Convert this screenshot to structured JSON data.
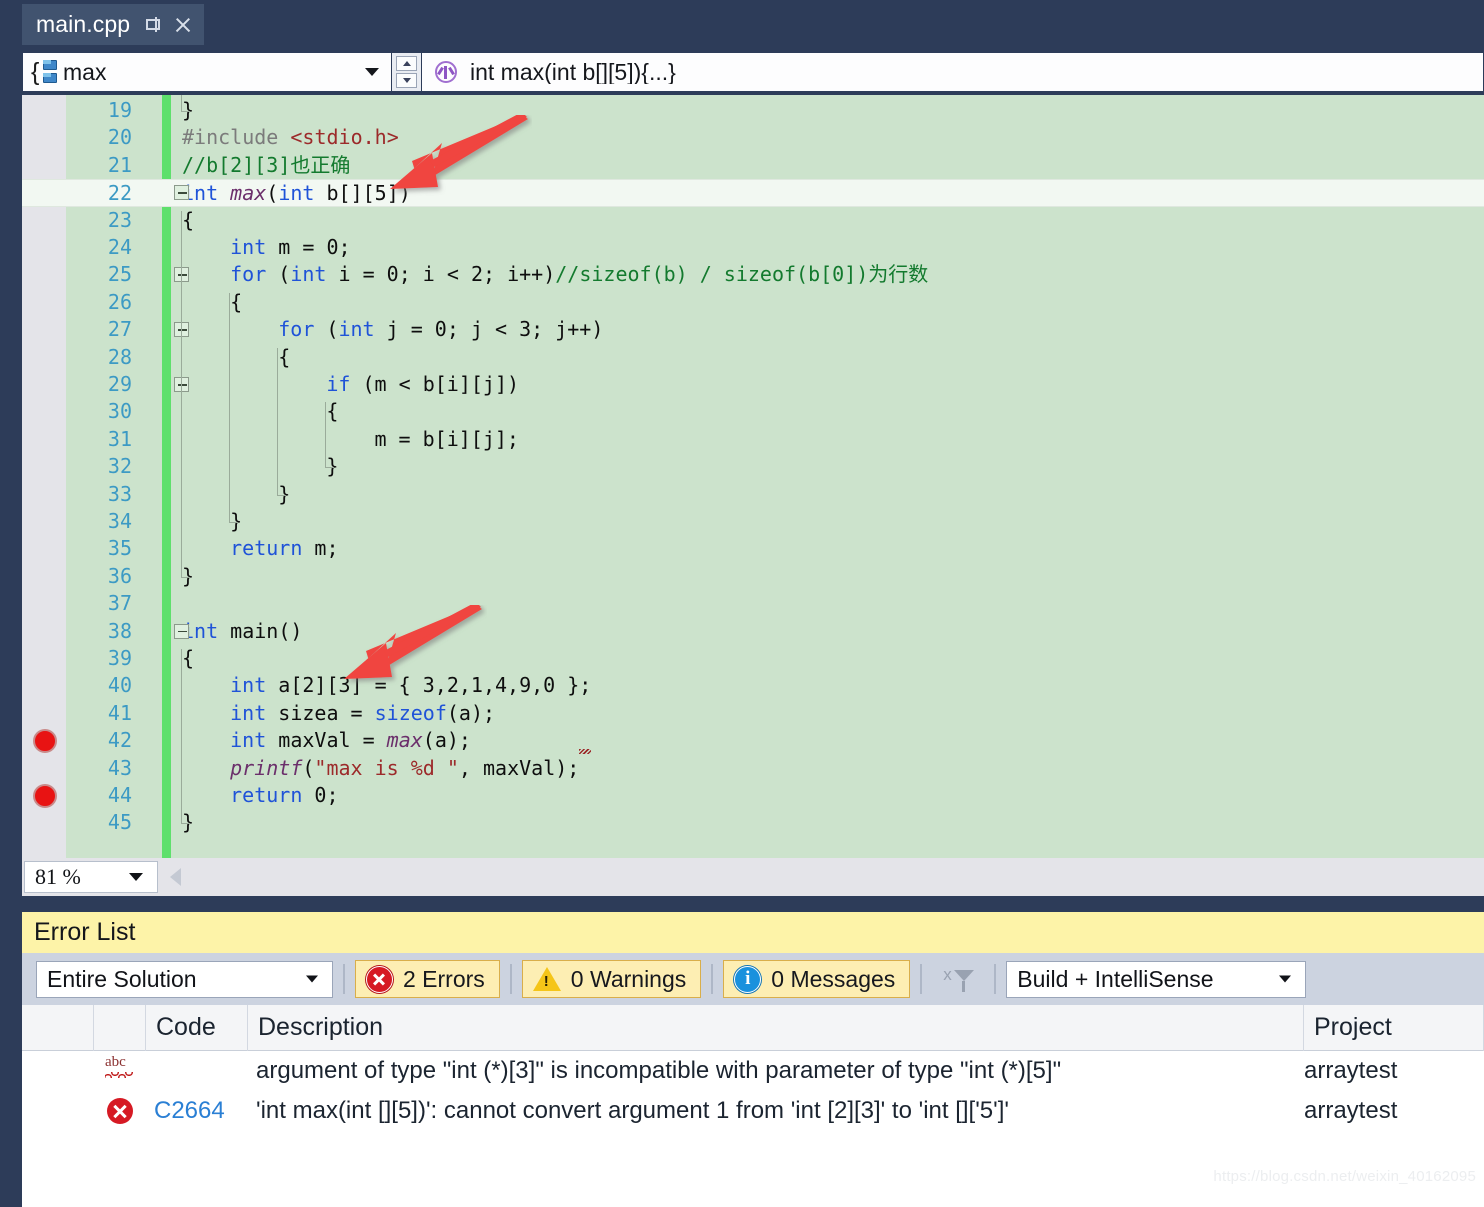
{
  "window": {
    "tab": {
      "title": "main.cpp",
      "pin_icon": "pin-icon",
      "close_icon": "close-icon"
    }
  },
  "navbar": {
    "scope_icon": "class-members-icon",
    "scope_value": "max",
    "member_icon": "method-icon",
    "member_value": "int max(int b[][5]){...}"
  },
  "editor": {
    "zoom_level": "81 %",
    "current_line": 22,
    "breakpoint_lines": [
      42,
      44
    ],
    "lines": [
      {
        "n": "19",
        "indent": 0,
        "html": "<span class=\"p\">}</span>"
      },
      {
        "n": "20",
        "indent": 0,
        "text": "#include <stdio.h>"
      },
      {
        "n": "21",
        "indent": 0,
        "text": "//b[2][3]也正确"
      },
      {
        "n": "22",
        "indent": 0,
        "text": "int max(int b[][5])"
      },
      {
        "n": "23",
        "indent": 0,
        "text": "{"
      },
      {
        "n": "24",
        "indent": 1,
        "text": "int m = 0;"
      },
      {
        "n": "25",
        "indent": 1,
        "text": "for (int i = 0; i < 2; i++)//sizeof(b) / sizeof(b[0])为行数"
      },
      {
        "n": "26",
        "indent": 1,
        "text": "{"
      },
      {
        "n": "27",
        "indent": 2,
        "text": "for (int j = 0; j < 3; j++)"
      },
      {
        "n": "28",
        "indent": 2,
        "text": "{"
      },
      {
        "n": "29",
        "indent": 3,
        "text": "if (m < b[i][j])"
      },
      {
        "n": "30",
        "indent": 3,
        "text": "{"
      },
      {
        "n": "31",
        "indent": 4,
        "text": "m = b[i][j];"
      },
      {
        "n": "32",
        "indent": 3,
        "text": "}"
      },
      {
        "n": "33",
        "indent": 2,
        "text": "}"
      },
      {
        "n": "34",
        "indent": 1,
        "text": "}"
      },
      {
        "n": "35",
        "indent": 1,
        "text": "return m;"
      },
      {
        "n": "36",
        "indent": 0,
        "text": "}"
      },
      {
        "n": "37",
        "indent": 0,
        "text": ""
      },
      {
        "n": "38",
        "indent": 0,
        "text": "int main()"
      },
      {
        "n": "39",
        "indent": 0,
        "text": "{"
      },
      {
        "n": "40",
        "indent": 1,
        "text": "int a[2][3] = { 3,2,1,4,9,0 };"
      },
      {
        "n": "41",
        "indent": 1,
        "text": "int sizea = sizeof(a);"
      },
      {
        "n": "42",
        "indent": 1,
        "text": "int maxVal = max(a);"
      },
      {
        "n": "43",
        "indent": 1,
        "text": "printf(\"max is %d \", maxVal);"
      },
      {
        "n": "44",
        "indent": 1,
        "text": "return 0;"
      },
      {
        "n": "45",
        "indent": 0,
        "text": "}"
      }
    ]
  },
  "error_list": {
    "title": "Error List",
    "scope_filter": "Entire Solution",
    "errors_label": "2 Errors",
    "warnings_label": "0 Warnings",
    "messages_label": "0 Messages",
    "clear_filter_icon": "clear-filter-icon",
    "build_filter": "Build + IntelliSense",
    "columns": [
      "",
      "",
      "Code",
      "Description",
      "Project"
    ],
    "rows": [
      {
        "icon": "intellisense-squiggle-icon",
        "code": "",
        "description": "argument of type \"int (*)[3]\" is incompatible with parameter of type \"int (*)[5]\"",
        "project": "arraytest"
      },
      {
        "icon": "error-icon",
        "code": "C2664",
        "description": "'int max(int [][5])': cannot convert argument 1 from 'int [2][3]' to 'int []['5']'",
        "project": "arraytest"
      }
    ]
  },
  "watermark": "https://blog.csdn.net/weixin_40162095",
  "colors": {
    "chrome": "#2d3c59",
    "editor_bg": "#cce3cc",
    "change_bar": "#5ee06c",
    "accent_yellow": "#fdf3a8",
    "error_red": "#d61a24",
    "arrow_red": "#f04a4a"
  }
}
